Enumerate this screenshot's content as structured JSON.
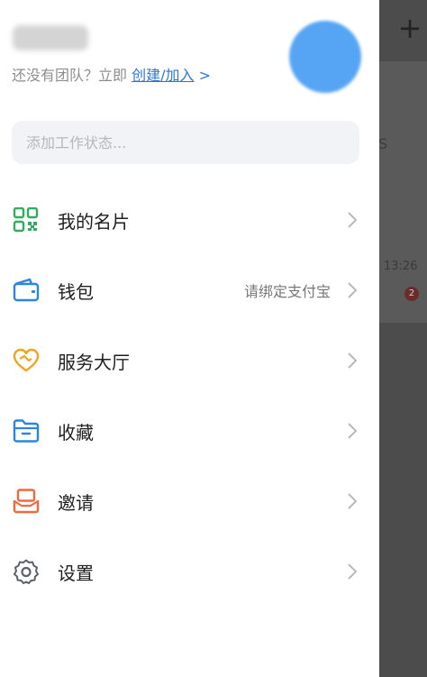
{
  "header": {
    "team_prompt": "还没有团队？立即",
    "team_link": "创建/加入",
    "team_link_chevron": ">"
  },
  "status": {
    "placeholder": "添加工作状态..."
  },
  "menu": [
    {
      "label": "我的名片",
      "icon": "qr-code-icon",
      "value": ""
    },
    {
      "label": "钱包",
      "icon": "wallet-icon",
      "value": "请绑定支付宝"
    },
    {
      "label": "服务大厅",
      "icon": "heart-handshake-icon",
      "value": ""
    },
    {
      "label": "收藏",
      "icon": "folder-icon",
      "value": ""
    },
    {
      "label": "邀请",
      "icon": "invite-envelope-icon",
      "value": ""
    },
    {
      "label": "设置",
      "icon": "gear-icon",
      "value": ""
    }
  ],
  "background": {
    "plus": "+",
    "time": "13:26",
    "badge": "2",
    "letter": "S"
  },
  "colors": {
    "accent": "#2c77d6",
    "qr": "#2fae5f",
    "wallet": "#2a86e0",
    "service": "#f0a41c",
    "folder": "#2a86e0",
    "invite": "#ee6a3c",
    "gear": "#5a6270"
  }
}
